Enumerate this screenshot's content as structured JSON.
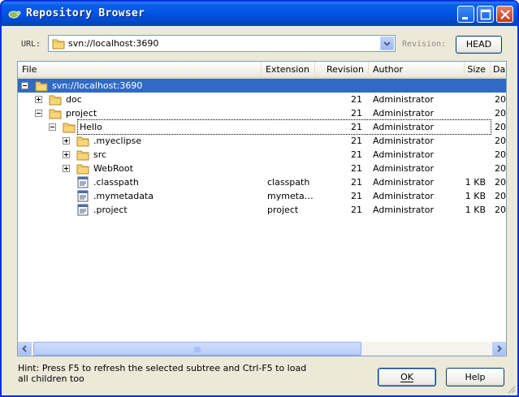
{
  "window": {
    "title": "Repository Browser",
    "controls": {
      "minimize": "minimize-icon",
      "maximize": "maximize-icon",
      "close": "close-icon"
    }
  },
  "toolbar": {
    "url_label": "URL:",
    "url_value": "svn://localhost:3690",
    "revision_label": "Revision:",
    "head_button": "HEAD"
  },
  "table": {
    "columns": [
      "File",
      "Extension",
      "Revision",
      "Author",
      "Size",
      "Da"
    ],
    "rows": [
      {
        "name": "svn://localhost:3690",
        "icon": "folder-open-icon",
        "expander": "minus",
        "ext": "",
        "rev": "",
        "author": "",
        "size": "",
        "date": ""
      },
      {
        "name": "doc",
        "icon": "folder-icon",
        "expander": "plus",
        "ext": "",
        "rev": "21",
        "author": "Administrator",
        "size": "",
        "date": "20"
      },
      {
        "name": "project",
        "icon": "folder-icon",
        "expander": "minus",
        "ext": "",
        "rev": "21",
        "author": "Administrator",
        "size": "",
        "date": "20"
      },
      {
        "name": "Hello",
        "icon": "folder-icon",
        "expander": "minus",
        "ext": "",
        "rev": "21",
        "author": "Administrator",
        "size": "",
        "date": "20"
      },
      {
        "name": ".myeclipse",
        "icon": "folder-icon",
        "expander": "plus",
        "ext": "",
        "rev": "21",
        "author": "Administrator",
        "size": "",
        "date": "20"
      },
      {
        "name": "src",
        "icon": "folder-icon",
        "expander": "plus",
        "ext": "",
        "rev": "21",
        "author": "Administrator",
        "size": "",
        "date": "20"
      },
      {
        "name": "WebRoot",
        "icon": "folder-icon",
        "expander": "plus",
        "ext": "",
        "rev": "21",
        "author": "Administrator",
        "size": "",
        "date": "20"
      },
      {
        "name": ".classpath",
        "icon": "file-icon",
        "expander": "",
        "ext": "classpath",
        "rev": "21",
        "author": "Administrator",
        "size": "1 KB",
        "date": "20"
      },
      {
        "name": ".mymetadata",
        "icon": "file-icon",
        "expander": "",
        "ext": "mymeta…",
        "rev": "21",
        "author": "Administrator",
        "size": "1 KB",
        "date": "20"
      },
      {
        "name": ".project",
        "icon": "file-icon",
        "expander": "",
        "ext": "project",
        "rev": "21",
        "author": "Administrator",
        "size": "1 KB",
        "date": "20"
      }
    ],
    "selected_row": 0
  },
  "footer": {
    "hint": "Hint: Press F5 to refresh the selected subtree and Ctrl-F5 to load all children too",
    "ok_label": "OK",
    "help_label": "Help"
  },
  "colors": {
    "titlebar": "#0054e3",
    "selection": "#316ac5",
    "window_bg": "#ece9d8"
  }
}
